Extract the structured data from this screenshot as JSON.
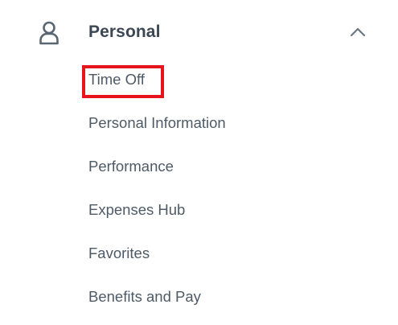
{
  "section": {
    "title": "Personal",
    "icon": "person-icon",
    "expanded_icon": "chevron-up-icon"
  },
  "menu": {
    "items": [
      {
        "label": "Time Off",
        "highlighted": true
      },
      {
        "label": "Personal Information"
      },
      {
        "label": "Performance"
      },
      {
        "label": "Expenses Hub"
      },
      {
        "label": "Favorites"
      },
      {
        "label": "Benefits and Pay"
      }
    ]
  },
  "colors": {
    "text": "#4e5a66",
    "title": "#3c4754",
    "highlight": "#e8141b",
    "background": "#ffffff"
  }
}
